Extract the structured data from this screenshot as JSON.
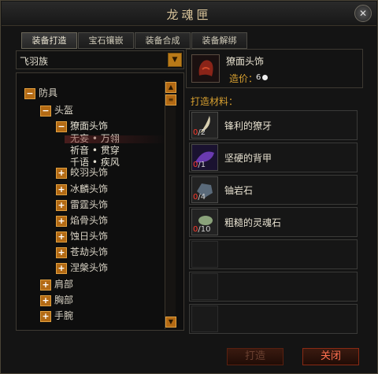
{
  "window": {
    "title": "龙魂匣",
    "close_glyph": "✕"
  },
  "tabs": [
    {
      "label": "装备打造",
      "active": true
    },
    {
      "label": "宝石镶嵌",
      "active": false
    },
    {
      "label": "装备合成",
      "active": false
    },
    {
      "label": "装备解绑",
      "active": false
    }
  ],
  "category_select": {
    "value": "飞羽族"
  },
  "tree": {
    "root": "防具",
    "sub": "头盔",
    "selected": "獠面头饰",
    "selected_attrs": [
      "无妄 • 万翎",
      "祈音 • 贯穿",
      "千语 • 疾风"
    ],
    "helmets": [
      "皎羽头饰",
      "冰麟头饰",
      "雷霆头饰",
      "焰骨头饰",
      "蚀日头饰",
      "苍劫头饰",
      "涅槃头饰"
    ],
    "others": [
      "肩部",
      "胸部",
      "手腕"
    ]
  },
  "item": {
    "name": "獠面头饰",
    "cost_label": "造价：",
    "cost_value": "6"
  },
  "materials_title": "打造材料：",
  "materials": [
    {
      "name": "锋利的獠牙",
      "have": "0",
      "need": "/2"
    },
    {
      "name": "坚硬的背甲",
      "have": "0",
      "need": "/1"
    },
    {
      "name": "铀岩石",
      "have": "0",
      "need": "/4"
    },
    {
      "name": "粗糙的灵魂石",
      "have": "0",
      "need": "/10"
    }
  ],
  "buttons": {
    "craft": "打造",
    "close": "关闭"
  },
  "colors": {
    "accent": "#b36a14",
    "material_title": "#d8a030",
    "count_missing": "#ff3b2e"
  }
}
